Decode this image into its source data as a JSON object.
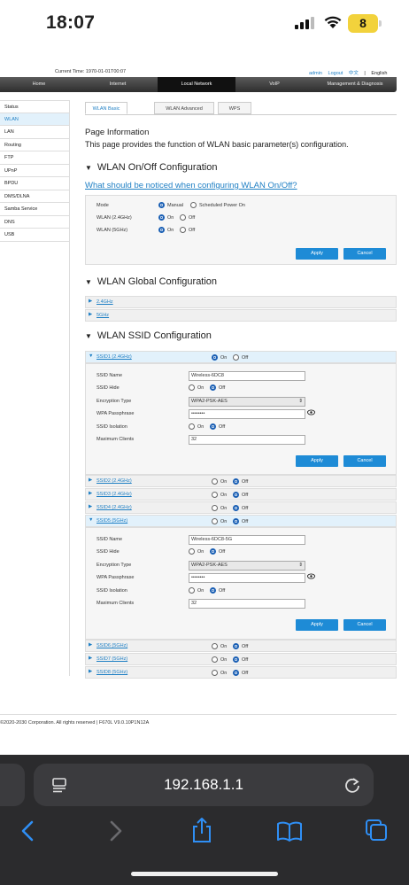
{
  "status_bar": {
    "time": "18:07",
    "battery": "8"
  },
  "header": {
    "current_time": "Current Time: 1970-01-01T00:07",
    "links": [
      "admin",
      "Logout",
      "中文",
      "|",
      "English"
    ]
  },
  "nav": [
    "Home",
    "Internet",
    "Local Network",
    "VoIP",
    "Management & Diagnosis"
  ],
  "sidebar": [
    "Status",
    "WLAN",
    "LAN",
    "Routing",
    "FTP",
    "UPnP",
    "BPDU",
    "DMS/DLNA",
    "Samba Service",
    "DNS",
    "USB"
  ],
  "tabs": [
    "WLAN Basic",
    "WLAN Advanced",
    "WPS"
  ],
  "page_info": {
    "title": "Page Information",
    "text": "This page provides the function of WLAN basic parameter(s) configuration."
  },
  "onoff": {
    "title": "WLAN On/Off Configuration",
    "notice_link": "What should be noticed when configuring WLAN On/Off?",
    "mode_label": "Mode",
    "mode_manual": "Manual",
    "mode_scheduled": "Scheduled Power On",
    "wlan24_label": "WLAN (2.4GHz)",
    "wlan5_label": "WLAN (5GHz)",
    "on": "On",
    "off": "Off",
    "apply": "Apply",
    "cancel": "Cancel"
  },
  "global": {
    "title": "WLAN Global Configuration",
    "bands": [
      "2.4GHz",
      "5GHz"
    ]
  },
  "ssid_section": {
    "title": "WLAN SSID Configuration",
    "field_labels": {
      "name": "SSID Name",
      "hide": "SSID Hide",
      "encryption": "Encryption Type",
      "passphrase": "WPA Passphrase",
      "isolation": "SSID Isolation",
      "max_clients": "Maximum Clients"
    },
    "on": "On",
    "off": "Off",
    "apply": "Apply",
    "cancel": "Cancel",
    "ssids": [
      "SSID1 (2.4GHz)",
      "SSID2 (2.4GHz)",
      "SSID3 (2.4GHz)",
      "SSID4 (2.4GHz)",
      "SSID5 (5GHz)",
      "SSID6 (5GHz)",
      "SSID7 (5GHz)",
      "SSID8 (5GHz)"
    ],
    "ssid1": {
      "name": "Wireless-6DC8",
      "encryption": "WPA2-PSK-AES",
      "passphrase": "••••••••",
      "max_clients": "32"
    },
    "ssid5": {
      "name": "Wireless-6DC8-5G",
      "encryption": "WPA2-PSK-AES",
      "passphrase": "••••••••",
      "max_clients": "32"
    }
  },
  "footer": "©2020-2030 Corporation. All rights reserved  |   F670L V9.0.10P1N12A",
  "browser": {
    "url": "192.168.1.1"
  }
}
